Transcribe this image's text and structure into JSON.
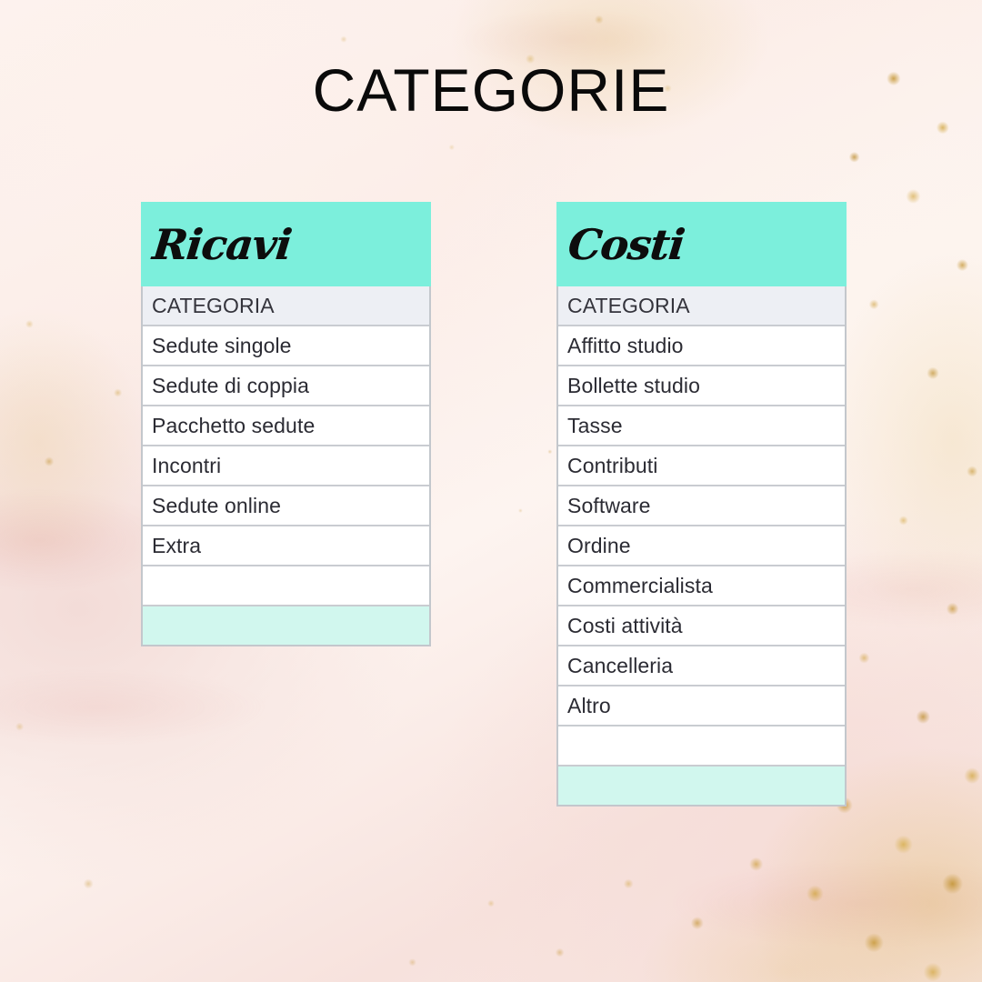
{
  "page": {
    "title": "CATEGORIE",
    "background_description": "blush pink marble with gold flecks"
  },
  "colors": {
    "banner_mint": "#7CEFDC",
    "footer_mint": "#D1F7EE",
    "header_row_gray": "#EDEFF4",
    "row_border": "#C9CCD1",
    "text": "#2B2B33",
    "title_text": "#0A0A0A",
    "page_background": "#FBEEE8",
    "gold_fleck": "#C89632"
  },
  "tables": [
    {
      "id": "ricavi",
      "banner_title": "Ricavi",
      "column_header": "CATEGORIA",
      "rows": [
        "Sedute singole",
        "Sedute di coppia",
        "Pacchetto sedute",
        "Incontri",
        "Sedute online",
        "Extra"
      ],
      "empty_row": "",
      "footer_row": ""
    },
    {
      "id": "costi",
      "banner_title": "Costi",
      "column_header": "CATEGORIA",
      "rows": [
        "Affitto studio",
        "Bollette studio",
        "Tasse",
        "Contributi",
        "Software",
        "Ordine",
        "Commercialista",
        "Costi attività",
        "Cancelleria",
        "Altro"
      ],
      "empty_row": "",
      "footer_row": ""
    }
  ]
}
